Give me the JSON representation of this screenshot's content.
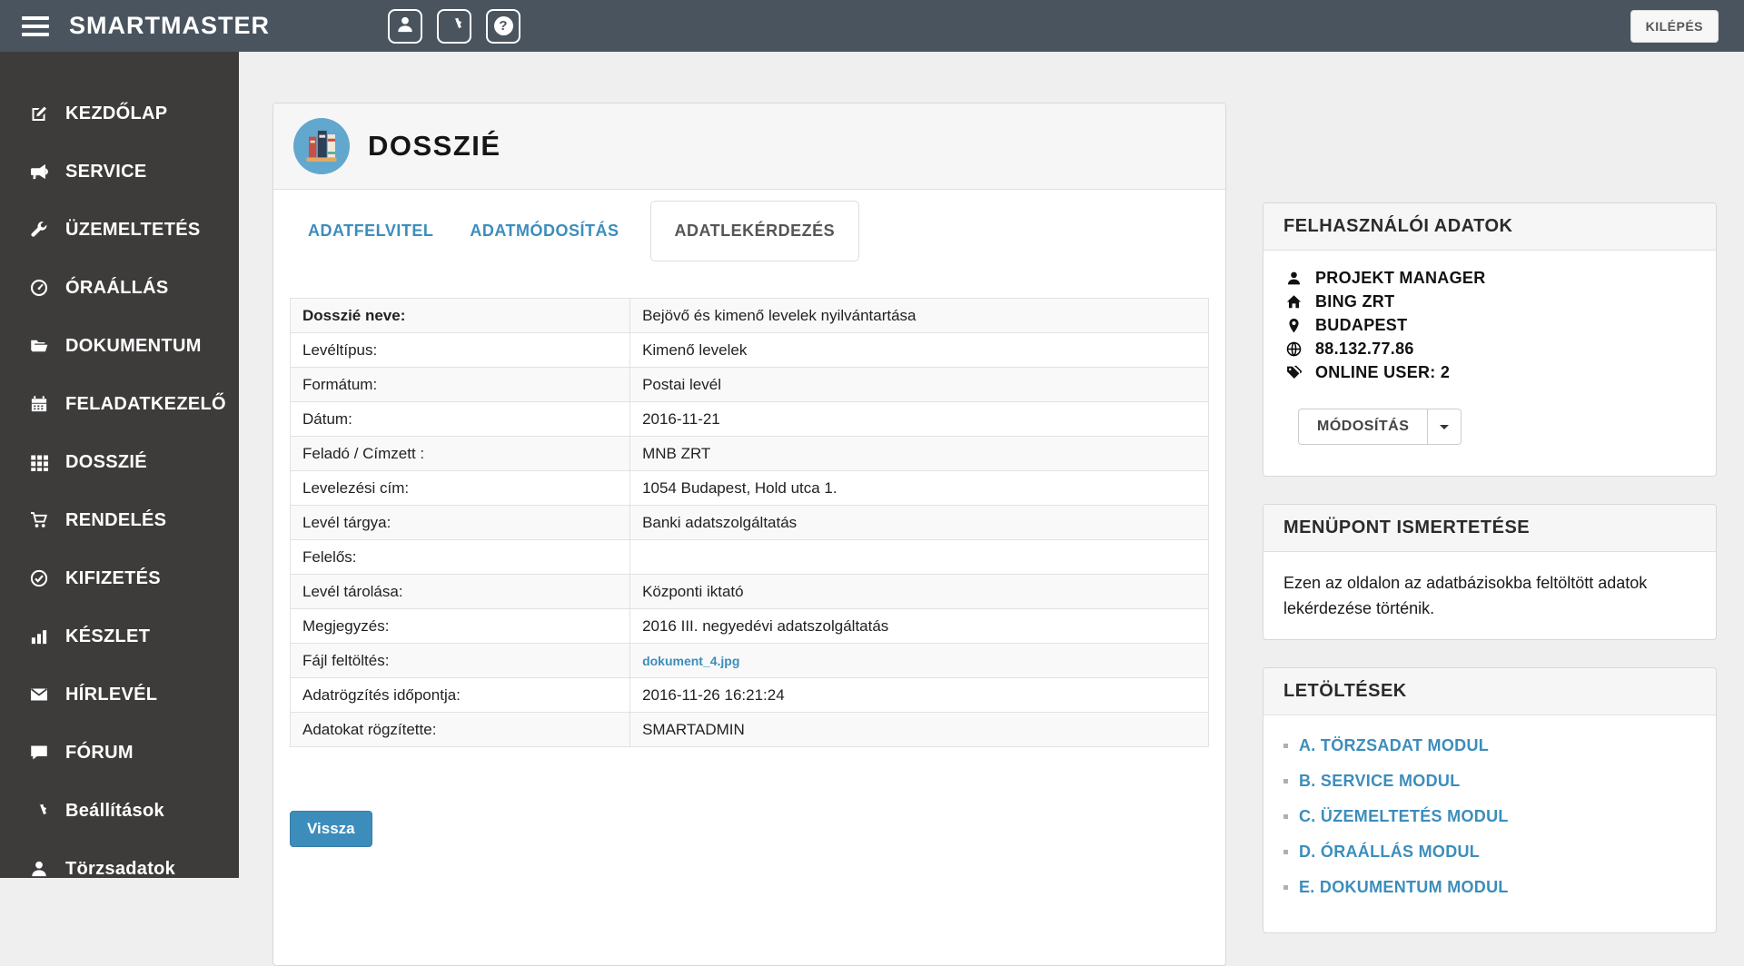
{
  "colors": {
    "accent": "#3c8dbc",
    "header_bg": "#4a545f",
    "sidebar_bg": "#3e3c3b"
  },
  "header": {
    "brand": "SMARTMASTER",
    "logout_label": "KILÉPÉS",
    "icon_buttons": [
      "user-icon",
      "gear-icon",
      "question-icon"
    ]
  },
  "sidebar": {
    "items": [
      {
        "label": "KEZDŐLAP",
        "icon": "edit-icon"
      },
      {
        "label": "SERVICE",
        "icon": "bullhorn-icon"
      },
      {
        "label": "ÜZEMELTETÉS",
        "icon": "wrench-icon"
      },
      {
        "label": "ÓRAÁLLÁS",
        "icon": "gauge-icon"
      },
      {
        "label": "DOKUMENTUM",
        "icon": "folder-open-icon"
      },
      {
        "label": "FELADATKEZELŐ",
        "icon": "calendar-icon"
      },
      {
        "label": "DOSSZIÉ",
        "icon": "grid-icon"
      },
      {
        "label": "RENDELÉS",
        "icon": "cart-icon"
      },
      {
        "label": "KIFIZETÉS",
        "icon": "check-circle-icon"
      },
      {
        "label": "KÉSZLET",
        "icon": "bar-chart-icon"
      },
      {
        "label": "HÍRLEVÉL",
        "icon": "envelope-icon"
      },
      {
        "label": "FÓRUM",
        "icon": "comment-icon"
      },
      {
        "label": "Beállítások",
        "icon": "gear-icon"
      },
      {
        "label": "Törzsadatok",
        "icon": "user-icon"
      }
    ]
  },
  "main": {
    "page_title": "DOSSZIÉ",
    "page_icon": "books-icon",
    "tabs": [
      {
        "label": "ADATFELVITEL",
        "active": false
      },
      {
        "label": "ADATMÓDOSÍTÁS",
        "active": false
      },
      {
        "label": "ADATLEKÉRDEZÉS",
        "active": true
      }
    ],
    "table": {
      "rows": [
        {
          "label": "Dosszié neve:",
          "value": "Bejövő és kimenő levelek nyilvántartása"
        },
        {
          "label": "Levéltípus:",
          "value": "Kimenő levelek"
        },
        {
          "label": "Formátum:",
          "value": "Postai levél"
        },
        {
          "label": "Dátum:",
          "value": "2016-11-21"
        },
        {
          "label": "Feladó / Címzett :",
          "value": "MNB ZRT"
        },
        {
          "label": "Levelezési cím:",
          "value": "1054 Budapest, Hold utca 1."
        },
        {
          "label": "Levél tárgya:",
          "value": "Banki adatszolgáltatás"
        },
        {
          "label": "Felelős:",
          "value": ""
        },
        {
          "label": "Levél tárolása:",
          "value": "Központi iktató"
        },
        {
          "label": "Megjegyzés:",
          "value": "2016 III. negyedévi adatszolgáltatás"
        },
        {
          "label": "Fájl feltöltés:",
          "value": "dokument_4.jpg",
          "link": true
        },
        {
          "label": "Adatrögzítés időpontja:",
          "value": "2016-11-26 16:21:24"
        },
        {
          "label": "Adatokat rögzítette:",
          "value": "SMARTADMIN"
        }
      ]
    },
    "back_button": "Vissza"
  },
  "right": {
    "user_panel": {
      "title": "FELHASZNÁLÓI ADATOK",
      "items": [
        {
          "icon": "user-icon",
          "text": "PROJEKT MANAGER"
        },
        {
          "icon": "home-icon",
          "text": "BING ZRT"
        },
        {
          "icon": "map-marker-icon",
          "text": "BUDAPEST"
        },
        {
          "icon": "globe-icon",
          "text": "88.132.77.86"
        },
        {
          "icon": "tags-icon",
          "text": "ONLINE USER: 2"
        }
      ],
      "modify_button": "MÓDOSÍTÁS"
    },
    "menu_info_panel": {
      "title": "MENÜPONT ISMERTETÉSE",
      "text": "Ezen az oldalon az adatbázisokba feltöltött adatok lekérdezése történik."
    },
    "downloads_panel": {
      "title": "LETÖLTÉSEK",
      "links": [
        "A. TÖRZSADAT MODUL",
        "B. SERVICE MODUL",
        "C. ÜZEMELTETÉS MODUL",
        "D. ÓRAÁLLÁS MODUL",
        "E. DOKUMENTUM MODUL"
      ]
    }
  }
}
